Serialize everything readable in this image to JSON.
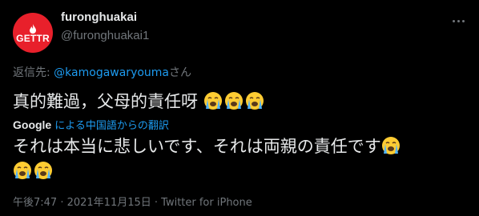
{
  "author": {
    "avatar_text": "GETTR",
    "name": "furonghuakai",
    "handle": "@furonghuakai1"
  },
  "reply": {
    "prefix": "返信先: ",
    "mention": "@kamogawaryouma",
    "suffix": "さん"
  },
  "tweet": {
    "text": "真的難過，父母的責任呀",
    "emoji": "loudly-crying-face"
  },
  "translation": {
    "provider": "Google",
    "label": "による中国語からの翻訳",
    "text": "それは本当に悲しいです、それは両親の責任です"
  },
  "meta": {
    "timestamp": "午後7:47 · 2021年11月15日 · Twitter for iPhone"
  },
  "colors": {
    "background": "#000000",
    "accent": "#1d9bf0",
    "muted": "#71767b",
    "avatar": "#e8202b"
  }
}
